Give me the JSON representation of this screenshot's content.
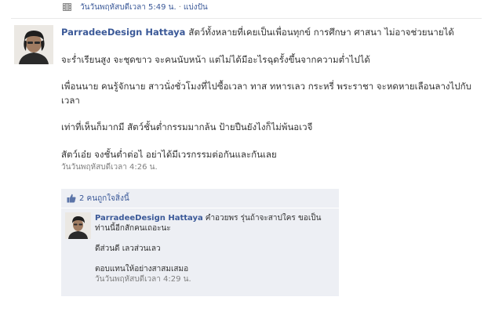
{
  "top_bar": {
    "timestamp": "วันวันพฤหัสบดีเวลา 5:49 น.",
    "separator": "·",
    "share_label": "แบ่งปัน"
  },
  "post": {
    "author": "ParradeeDesign Hattaya",
    "paragraphs": [
      "สัตว์ทั้งหลายที่เคยเป็นเพื่อนทุกข์ การศึกษา ศาสนา ไม่อาจช่วยนายได้",
      "จะร่ำเรียนสูง จะชุดขาว จะคนนับหน้า แต่ไม่ได้มีอะไรฉุดรั้งขึ้นจากความต่ำไปได้",
      "เพื่อนนาย คนรู้จักนาย สาวนั่งชั่วโมงที่ไปซื้อเวลา ทาส ทหารเลว กระหรี่ พระราชา จะหดหายเลือนลางไปกับเวลา",
      "เท่าที่เห็นก็มากมี สัตว์ชั้นต่ำกรรมมากล้น ป้ายปืนยังไงก็ไม่พ้นอเวจี",
      "สัตว์เอ๋ย จงชั้นต่ำต่อไ อย่าได้มีเวรกรรมต่อกันและกันเลย"
    ],
    "timestamp": "วันวันพฤหัสบดีเวลา 4:26 น."
  },
  "likes": {
    "label": "2 คนถูกใจสิ่งนี้"
  },
  "comment": {
    "author": "ParradeeDesign Hattaya",
    "paragraphs": [
      "คำอวยพร รุ่นถ้าจะสาปใคร ขอเป็นท่านนี้อีกสักคนเถอะนะ",
      "ดีส่วนดี เลวส่วนเลว",
      "ตอบแทนให้อย่างสาสมเสมอ"
    ],
    "timestamp": "วันวันพฤหัสบดีเวลา 4:29 น."
  },
  "colors": {
    "link": "#3b5998",
    "meta_text": "#808080",
    "body_text": "#333333",
    "panel_bg": "#edeff4"
  }
}
